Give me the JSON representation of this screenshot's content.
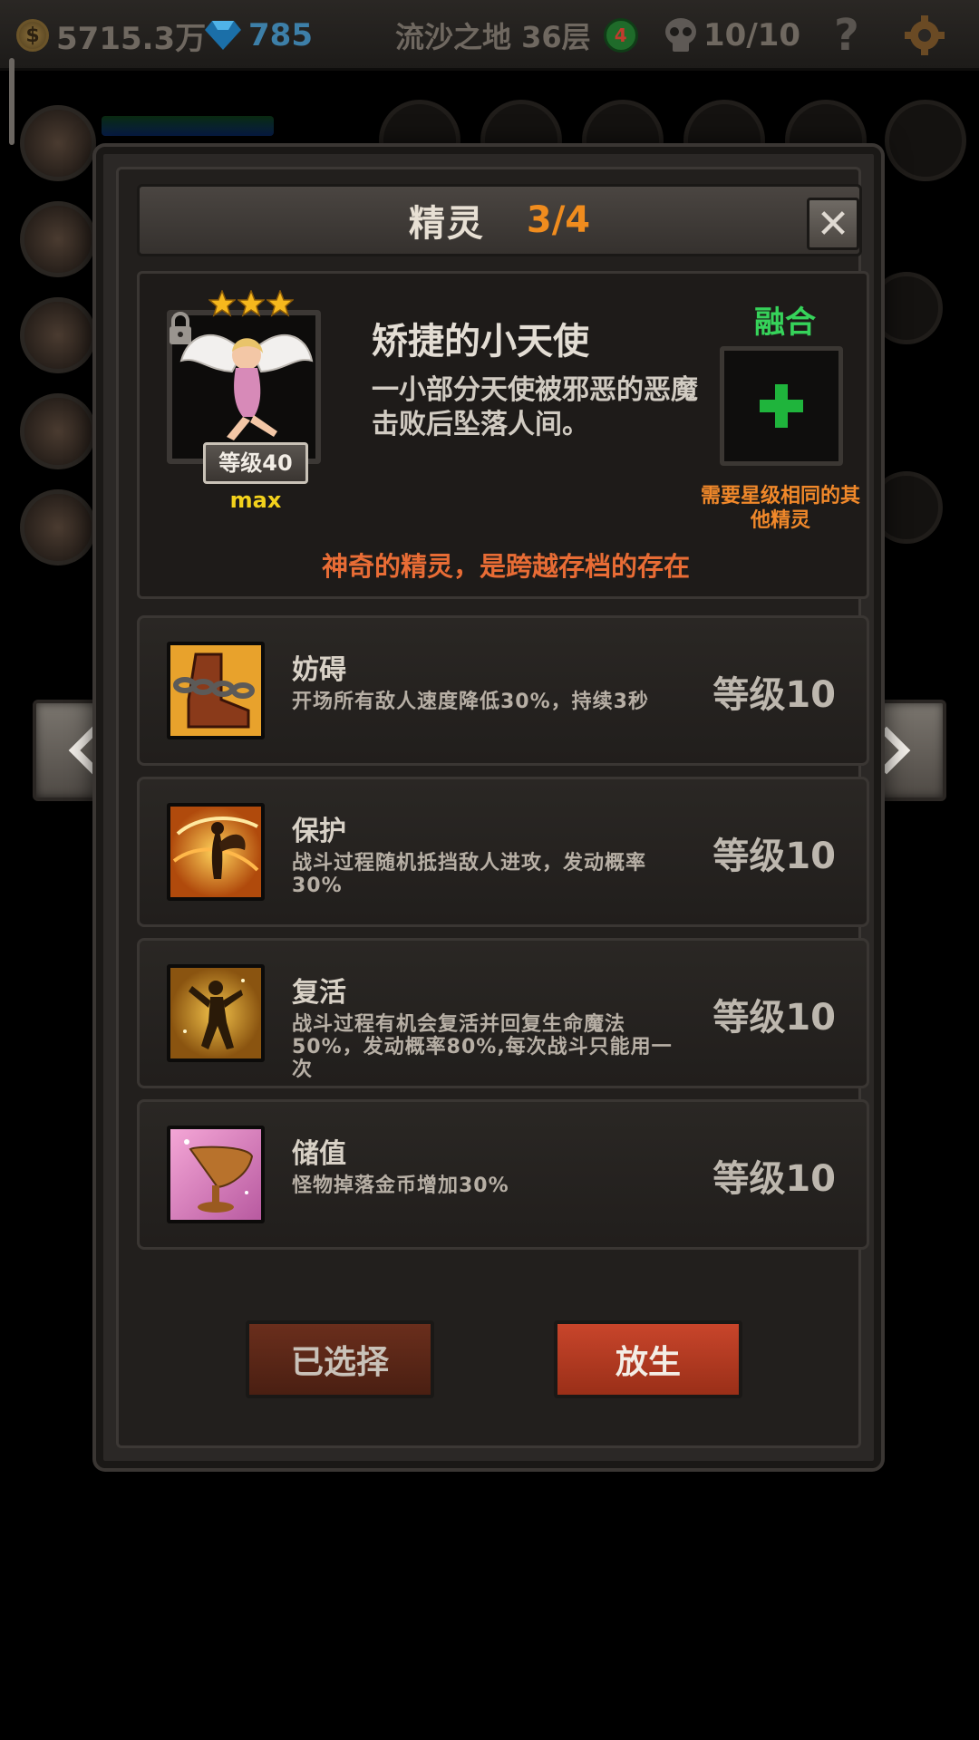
{
  "topbar": {
    "gold": "5715.3万",
    "gems": "785",
    "stage": "流沙之地 36层",
    "stage_badge": "4",
    "lives": "10/10",
    "help": "?"
  },
  "panel": {
    "title": "精灵",
    "count": "3/4",
    "close": "✕"
  },
  "sprite": {
    "name": "矫捷的小天使",
    "description": "一小部分天使被邪恶的恶魔击败后坠落人间。",
    "level": "等级40",
    "level_max": "max",
    "stars": 3,
    "fuse_label": "融合",
    "fuse_hint": "需要星级相同的其他精灵",
    "tagline": "神奇的精灵，是跨越存档的存在"
  },
  "skills": [
    {
      "name": "妨碍",
      "desc": "开场所有敌人速度降低30%，持续3秒",
      "level": "等级10",
      "icon": "chain-boot-icon"
    },
    {
      "name": "保护",
      "desc": "战斗过程随机抵挡敌人进攻，发动概率30%",
      "level": "等级10",
      "icon": "fairy-shield-icon"
    },
    {
      "name": "复活",
      "desc": "战斗过程有机会复活并回复生命魔法50%，发动概率80%,每次战斗只能用一次",
      "level": "等级10",
      "icon": "revive-dancer-icon"
    },
    {
      "name": "储值",
      "desc": "怪物掉落金币增加30%",
      "level": "等级10",
      "icon": "golden-chalice-icon"
    }
  ],
  "buttons": {
    "selected": "已选择",
    "release": "放生"
  },
  "colors": {
    "accent_orange": "#f08c1e",
    "fuse_green": "#36d35a",
    "tagline_red": "#e86c35",
    "release_red": "#c8452b"
  }
}
